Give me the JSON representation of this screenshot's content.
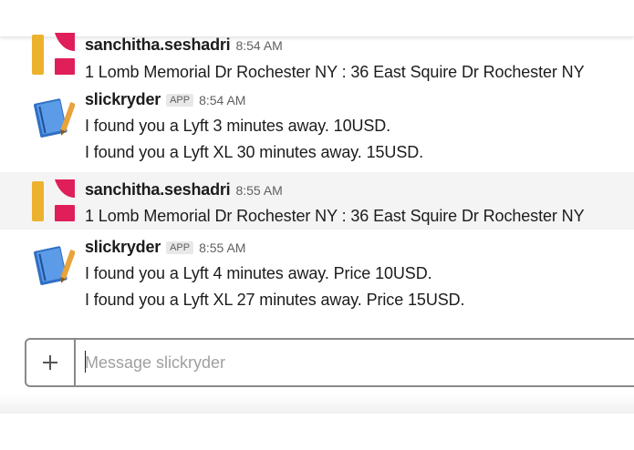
{
  "messages": [
    {
      "sender": "sanchitha.seshadri",
      "time": "8:54 AM",
      "lines": [
        "1 Lomb Memorial Dr Rochester NY : 36 East Squire Dr Rochester NY"
      ]
    },
    {
      "sender": "slickryder",
      "badge": "APP",
      "time": "8:54 AM",
      "lines": [
        "I found you a Lyft 3 minutes away. 10USD.",
        "I found you a Lyft XL 30 minutes away. 15USD."
      ]
    },
    {
      "sender": "sanchitha.seshadri",
      "time": "8:55 AM",
      "lines": [
        "1 Lomb Memorial Dr Rochester NY : 36 East Squire Dr Rochester NY"
      ]
    },
    {
      "sender": "slickryder",
      "badge": "APP",
      "time": "8:55 AM",
      "lines": [
        "I found you a Lyft 4 minutes away. Price 10USD.",
        "I found you a Lyft XL 27 minutes away. Price 15USD."
      ]
    }
  ],
  "composer": {
    "placeholder": "Message slickryder",
    "value": "",
    "plus_icon": "plus-icon"
  },
  "colors": {
    "user_avatar_red": "#e01e5a",
    "user_avatar_yellow": "#ecb22e",
    "bot_avatar_blue": "#3a7bd5",
    "highlight_row": "#f4f4f4"
  }
}
